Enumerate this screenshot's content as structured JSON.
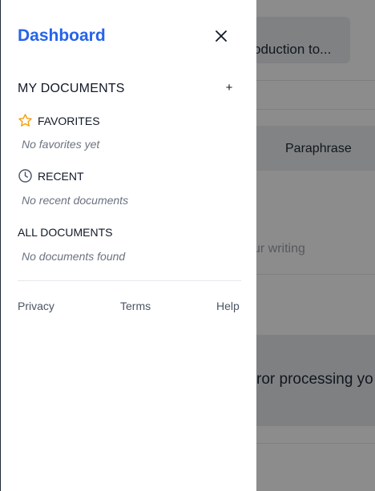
{
  "background": {
    "card_text": "oduction to...",
    "tab_label": "Paraphrase",
    "writing_hint": "ur writing",
    "error_text": "ror processing yo"
  },
  "drawer": {
    "title": "Dashboard",
    "section_title": "MY DOCUMENTS",
    "add_label": "+",
    "favorites": {
      "label": "FAVORITES",
      "empty": "No favorites yet"
    },
    "recent": {
      "label": "RECENT",
      "empty": "No recent documents"
    },
    "all": {
      "label": "ALL DOCUMENTS",
      "empty": "No documents found"
    },
    "footer": {
      "privacy": "Privacy",
      "terms": "Terms",
      "help": "Help"
    }
  },
  "icons": {
    "close": "close-icon",
    "favorites": "star-icon",
    "recent": "clock-icon"
  },
  "colors": {
    "accent": "#2563eb",
    "star": "#f59e0b"
  }
}
